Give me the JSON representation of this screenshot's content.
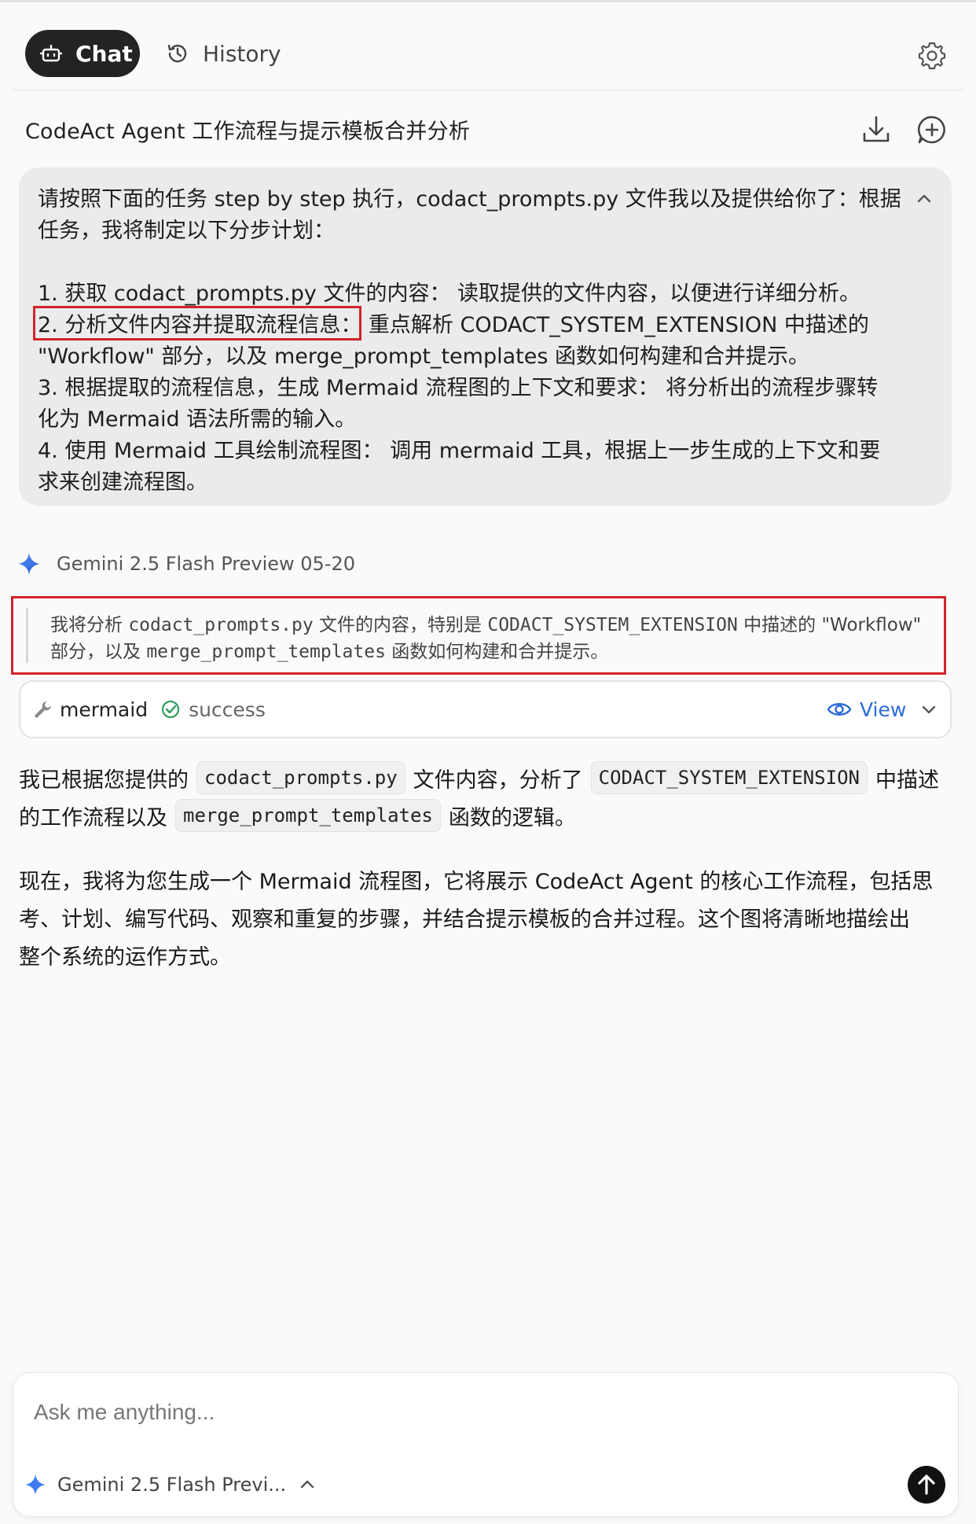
{
  "header": {
    "tabs": [
      {
        "label": "Chat",
        "icon": "bot-icon"
      },
      {
        "label": "History",
        "icon": "history-icon"
      }
    ],
    "settings_icon": "gear-icon"
  },
  "conversation": {
    "title": "CodeAct Agent 工作流程与提示模板合并分析",
    "actions": [
      "download-icon",
      "new-chat-icon"
    ]
  },
  "user_message": {
    "lines": [
      "请按照下面的任务 step by step 执行，codact_prompts.py 文件我以及提供给你了：根据",
      "任务，我将制定以下分步计划：",
      "1. 获取 codact_prompts.py 文件的内容： 读取提供的文件内容，以便进行详细分析。",
      "2. 分析文件内容并提取流程信息： 重点解析 CODACT_SYSTEM_EXTENSION 中描述的",
      "\"Workflow\" 部分，以及 merge_prompt_templates 函数如何构建和合并提示。",
      "3. 根据提取的流程信息，生成 Mermaid 流程图的上下文和要求： 将分析出的流程步骤转",
      "化为 Mermaid 语法所需的输入。",
      "4. 使用 Mermaid 工具绘制流程图： 调用 mermaid 工具，根据上一步生成的上下文和要",
      "求来创建流程图。"
    ]
  },
  "assistant": {
    "model_name": "Gemini 2.5 Flash Preview 05-20",
    "thinking": {
      "line1": {
        "a": "我将分析",
        "b": "codact_prompts.py",
        "c": "文件的内容，特别是",
        "d": "CODACT_SYSTEM_EXTENSION",
        "e": "中描述的 \"Workflow\""
      },
      "line2": {
        "a": "部分，以及",
        "b": "merge_prompt_templates",
        "c": "函数如何构建和合并提示。"
      }
    },
    "tool_call": {
      "name": "mermaid",
      "status": "success",
      "view_label": "View"
    },
    "response": {
      "p1_line1": {
        "a": "我已根据您提供的",
        "code1": "codact_prompts.py",
        "b": "文件内容，分析了",
        "code2": "CODACT_SYSTEM_EXTENSION",
        "c": "中描述"
      },
      "p1_line2": {
        "a": "的工作流程以及",
        "code": "merge_prompt_templates",
        "b": "函数的逻辑。"
      },
      "p2_lines": [
        "现在，我将为您生成一个 Mermaid 流程图，它将展示 CodeAct Agent 的核心工作流程，包括思",
        "考、计划、编写代码、观察和重复的步骤，并结合提示模板的合并过程。这个图将清晰地描绘出",
        "整个系统的运作方式。"
      ]
    }
  },
  "composer": {
    "placeholder": "Ask me anything...",
    "value": "",
    "model_label": "Gemini 2.5 Flash Previ...",
    "send_icon": "arrow-up-icon"
  },
  "colors": {
    "accent_blue": "#2c6bd8",
    "highlight_red": "#d2232a",
    "success_green": "#2e9d5b",
    "dark_pill": "#232323"
  }
}
